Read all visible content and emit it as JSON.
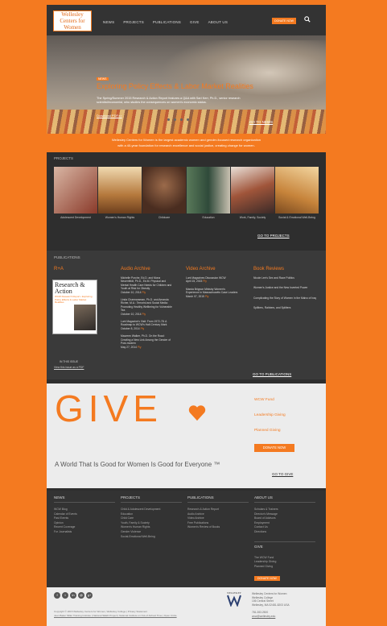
{
  "header": {
    "logo_lines": [
      "Wellesley",
      "Centers for",
      "Women"
    ],
    "nav": [
      "NEWS",
      "PROJECTS",
      "PUBLICATIONS",
      "GIVE",
      "ABOUT US"
    ],
    "donate": "DONATE NOW"
  },
  "hero": {
    "tag": "NEWS",
    "title": "Exploring Policy Effects & Labor Market Realities",
    "subtitle": "The Spring/Summer 2015 Research & Action Report features a Q&A with Sari Kerr, Ph.D., senior research scientist/economist, who studies the consequences on women's economic status.",
    "download": "Download PDF>>",
    "go": "GO TO NEWS"
  },
  "mission": {
    "line1": "Wellesley Centers for Women is the largest academic women and gender-focused research organization",
    "line2": "with a 40-year foundation for research excellence and social justice, creating change for women."
  },
  "projects": {
    "label": "PROJECTS",
    "items": [
      "Adolescent Development",
      "Women's Human Rights",
      "Childcare",
      "Education",
      "Work, Family, Society",
      "Social & Emotional Well-Being"
    ],
    "go": "GO TO PROJECTS"
  },
  "publications": {
    "label": "PUBLICATIONS",
    "ra": {
      "head": "R+A",
      "cover_title": "Research & Action",
      "cover_sub": "WCW Research Report • Exploring Policy Effects & Labor Market Realities",
      "in_issue": "IN THIS ISSUE",
      "view": "View this issue as a PDF"
    },
    "audio": {
      "head": "Audio Archive",
      "items": [
        {
          "text": "Michelle Porche, Ed.D. and Mona Neuenfeldt, Ph.D., Ed.M. Physical and Mental Health Care Needs for Children and Youth at Risk for Obesity",
          "date": "October 10, 2014",
          "play": "Ply"
        },
        {
          "text": "Linda Charmaraman, Ph.D. and Amanda Richer, M.A.: Terrorist and Social Media: Promoting Healthy Wellbeing for Vulnerable Tea",
          "date": "October 10, 2014",
          "play": "Ply"
        },
        {
          "text": "Lunt Magazine's Visit: From 1972-78: A Roadmap to WCW's Half-Century Mark",
          "date": "October 8, 2014",
          "play": "Ply"
        },
        {
          "text": "Maureen Walker, Ph.D. On the Road: Creating a New Link Among the Gender of Post-modern",
          "date": "May 27, 2014",
          "play": "Ply"
        }
      ]
    },
    "video": {
      "head": "Video Archive",
      "items": [
        {
          "text": "Lunt Magazines Discussion WCW",
          "date": "April 15, 2015",
          "play": "Ply"
        },
        {
          "text": "Marcia Brignon Ministry Women's Experience in Massachusetts Case Leaders",
          "date": "March 07, 2015",
          "play": "Ply"
        }
      ]
    },
    "books": {
      "head": "Book Reviews",
      "items": [
        "Nicole Lee's Sex and Race Politics",
        "Women's Justice and the New Inverted Power",
        "Complicating the Story of Women in the Malvo of Iraq",
        "Splitters, Rahbers, and Splitters"
      ]
    },
    "go": "GO TO PUBLICATIONS"
  },
  "give": {
    "word": "GIVE",
    "links": [
      "WCW Fund",
      "Leadership Giving",
      "Planned Giving"
    ],
    "donate": "DONATE NOW",
    "tagline": "A World That Is Good for Women Is Good for Everyone ™",
    "go": "GO TO GIVE"
  },
  "footer": {
    "news": {
      "head": "NEWS",
      "items": [
        "WCW Blog",
        "Calendar of Events",
        "Past Events",
        "Opinion",
        "Recent Coverage",
        "For Journalists"
      ]
    },
    "projects": {
      "head": "PROJECTS",
      "items": [
        "Child & Adolescent Development",
        "Education",
        "Child Care",
        "Youth, Family & Society",
        "Women's Human Rights",
        "Gender Violence",
        "Social-Emotional Well-Being"
      ]
    },
    "publications": {
      "head": "PUBLICATIONS",
      "items": [
        "Research & Action Report",
        "Audio Archive",
        "Video Archive",
        "Free Publications",
        "Women's Review of Books"
      ]
    },
    "about": {
      "head": "ABOUT US",
      "items": [
        "Scholars & Trainers",
        "Director's Message",
        "Board of Advisors",
        "Employment",
        "Contact Us",
        "Directions"
      ]
    },
    "give": {
      "head": "GIVE",
      "items": [
        "The WCW Fund",
        "Leadership Giving",
        "Planned Giving"
      ],
      "donate": "DONATE NOW"
    }
  },
  "bottom": {
    "social": [
      "f",
      "t",
      "in",
      "@",
      "g+"
    ],
    "copyright": "Copyright © 2015 Wellesley Centers for Women, Wellesley College | Privacy Statement",
    "links": "Jean Baker Miller Training Institute | National SEED Project | National Institute on Out-of-School Time | Open Circle",
    "logo_text": "WELLESLEY",
    "address": [
      "Wellesley Centers for Women",
      "Wellesley College",
      "106 Central Street",
      "Wellesley, MA 02481-8203 USA",
      "",
      "781.283.2500",
      "wcw@wellesley.edu"
    ]
  }
}
